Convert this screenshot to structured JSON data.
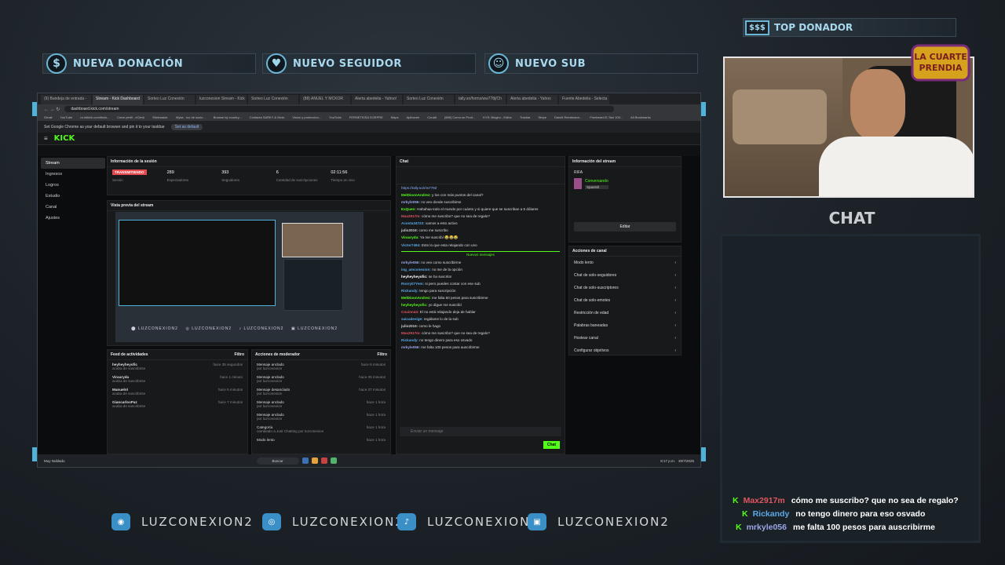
{
  "banners": {
    "donacion": "NUEVA DONACIÓN",
    "seguidor": "NUEVO SEGUIDOR",
    "sub": "NUEVO SUB",
    "top_donador": "TOP DONADOR"
  },
  "overlay": {
    "chat_title": "CHAT",
    "logo_line1": "LA CUARTE",
    "logo_line2": "PRENDIA",
    "messages": [
      {
        "user": "Max2917m",
        "text": "cómo me suscribo? que no sea de regalo?",
        "color": "#e05561"
      },
      {
        "user": "Rickandy",
        "text": "no tengo dinero para eso osvado",
        "color": "#5aa9e6"
      },
      {
        "user": "mrkyle056",
        "text": "me falta 100 pesos para auscribirme",
        "color": "#9aa6e8"
      }
    ]
  },
  "social": [
    {
      "icon": "discord-icon",
      "handle": "LUZCONEXION2"
    },
    {
      "icon": "instagram-icon",
      "handle": "LUZCONEXION2"
    },
    {
      "icon": "tiktok-icon",
      "handle": "LUZCONEXION2"
    },
    {
      "icon": "twitch-icon",
      "handle": "LUZCONEXION2"
    }
  ],
  "browser": {
    "tabs": [
      "(9) Bandeja de entrada -",
      "Stream - Kick Dashboard",
      "Sorteo Luz Conexión",
      "luzconexion Stream - Kick",
      "Sorteo Luz Conexión",
      "(88) ANUEL Y MCKOR",
      "Alerta abedelia - Yahoo!",
      "Sorteo Luz Conexión",
      "tally.so/forms/ww778j/Ch",
      "Alerta abedelia - Yahoo",
      "Fuente Abedelia - Selecta"
    ],
    "url": "dashboard.kick.com/stream",
    "bookmarks": [
      "Gmail",
      "YouTube",
      "ra.ridkick.com/feda...",
      "Crear perfil - eClerk",
      "Stickmaker",
      "Wyse - lux de socio...",
      "Browse by country...",
      "Contacta SARKY & More",
      "Vision y proteccion...",
      "YouTube",
      "FERNETKISA SORPRE",
      "Maps",
      "Apibuvee",
      "Conatl",
      "(985) Como se Prod...",
      "KYS: Blogeo - Editor",
      "Trasbar",
      "Stripe",
      "Danell Reedmann...",
      "Freebeard E-Taxi 100...",
      "All Bookmarks"
    ],
    "infobar_text": "Set Google Chrome as your default browser and pin it to your taskbar",
    "infobar_btn": "Set as default"
  },
  "kick": {
    "logo": "KICK",
    "sidebar": [
      "Stream",
      "Ingresos",
      "Logros",
      "Estudio",
      "Canal",
      "Ajustes"
    ],
    "session": {
      "title": "Información de la sesión",
      "live": "TRANSMITIENDO",
      "stats": [
        {
          "v": "289",
          "l": "Espectadores"
        },
        {
          "v": "393",
          "l": "Seguidores"
        },
        {
          "v": "6",
          "l": "Cantidad de suscripciones"
        },
        {
          "v": "02:11:56",
          "l": "Tiempo en vivo"
        }
      ],
      "session_label": "Sesión"
    },
    "preview_title": "Vista previa del stream",
    "feed": {
      "title": "Feed de actividades",
      "filter": "Filtro",
      "rows": [
        {
          "u": "heyheyheyofic",
          "s": "acaba de suscribirse",
          "t": "hace 35 segundos"
        },
        {
          "u": "Virauryda",
          "s": "acaba de suscribirse",
          "t": "hace 1 minuto"
        },
        {
          "u": "Manuelnl",
          "s": "acaba de suscribirse",
          "t": "hace 5 minutos"
        },
        {
          "u": "GiancarlosPaz",
          "s": "acaba de suscribirse",
          "t": "hace 7 minutos"
        }
      ]
    },
    "mod": {
      "title": "Acciones de moderador",
      "filter": "Filtro",
      "rows": [
        {
          "a": "Mensaje anclado",
          "b": "por luzconexion",
          "t": "hace 6 minutos"
        },
        {
          "a": "Mensaje anclado",
          "b": "por luzconexion",
          "t": "hace 35 minutos"
        },
        {
          "a": "Mensaje desanclado",
          "b": "por luzconexion",
          "t": "hace 37 minutos"
        },
        {
          "a": "Mensaje anclado",
          "b": "por luzconexion",
          "t": "hace 1 hora"
        },
        {
          "a": "Mensaje anclado",
          "b": "por luzconexion",
          "t": "hace 1 hora"
        },
        {
          "a": "Categoría",
          "b": "cambiado a Just Chatting por luzconexion",
          "t": "hace 1 hora"
        },
        {
          "a": "Modo lento",
          "b": "",
          "t": "hace 1 hora"
        }
      ]
    },
    "chat": {
      "title": "Chat",
      "pinned_link": "https://tally.so/r/w778Z",
      "new_messages": "Nuevos mensajes",
      "input_placeholder": "Enviar un mensaje",
      "send": "Chat",
      "lines": [
        {
          "u": "MelDioonAndrez",
          "t": "y los con más puntos del canal?",
          "c": "#53fc18"
        },
        {
          "u": "mrkyle056",
          "t": "no veo donde suscribirse",
          "c": "#9aa6e8"
        },
        {
          "u": "ExQuen",
          "t": "Hahahaa todo el mundo por cuánto y si quiere que se suscriban a 5 dólares",
          "c": "#53fc18"
        },
        {
          "u": "Max2917m",
          "t": "cómo me suscribo? que no sea de regalo?",
          "c": "#e05561"
        },
        {
          "u": "Acosta34723",
          "t": "vamos a esto activo",
          "c": "#5aa9e6"
        },
        {
          "u": "julio2016",
          "t": "como me suscribo",
          "c": "#ccc"
        },
        {
          "u": "Virauryda",
          "t": "Ya me suscribí 😂😂😂",
          "c": "#53fc18"
        },
        {
          "u": "Victor7494",
          "t": "Esto lo que esta relajando con uno",
          "c": "#5aa9e6"
        },
        {
          "u": "mrkyle056",
          "t": "no veo como suscribirme",
          "c": "#9aa6e8"
        },
        {
          "u": "ing_amconexion",
          "t": "no me de la opción",
          "c": "#5aa9e6"
        },
        {
          "u": "heyheyheyofic",
          "t": "se ha suscrito!",
          "c": "#fff"
        },
        {
          "u": "Rosry07Yem",
          "t": "si pero puedes contar con ese sub",
          "c": "#5aa9e6"
        },
        {
          "u": "Rickandy",
          "t": "tengo para suscripción",
          "c": "#5aa9e6"
        },
        {
          "u": "MelDioonAndrez",
          "t": "me falta 50 pesos para suscribirme",
          "c": "#53fc18"
        },
        {
          "u": "heyheyheyofic",
          "t": "yo digue me suscribí",
          "c": "#53fc18"
        },
        {
          "u": "Couinn44",
          "t": "El no está relajando deja de hablar",
          "c": "#e05561"
        },
        {
          "u": "saicadevige",
          "t": "regálame lo de la sub",
          "c": "#5aa9e6"
        },
        {
          "u": "julio2016",
          "t": "como le hago",
          "c": "#ccc"
        },
        {
          "u": "Max2917m",
          "t": "cómo me suscribo? que no sea de regalo?",
          "c": "#e05561"
        },
        {
          "u": "Rickandy",
          "t": "no tengo dinero para eso osvado",
          "c": "#5aa9e6"
        },
        {
          "u": "mrkyle056",
          "t": "me falta 100 pesos para auscribirme",
          "c": "#9aa6e8"
        }
      ]
    },
    "stream_info": {
      "title": "Información del stream",
      "name": "RIFA",
      "category": "Conversando",
      "lang": "Spanish",
      "edit": "Editar"
    },
    "channel_actions": {
      "title": "Acciones de canal",
      "items": [
        "Modo lento",
        "Chat de solo-seguidores",
        "Chat de solo-suscriptores",
        "Chat de solo-emotes",
        "Restricción de edad",
        "Palabras baneadas",
        "Hostear canal",
        "Configurar objetivos"
      ],
      "slow_value": "30 s"
    }
  },
  "taskbar": {
    "user": "Muy Nublado",
    "weather": "Alerta",
    "search": "Buscar",
    "time": "8:17 p.m.",
    "date": "30/7/2025"
  }
}
